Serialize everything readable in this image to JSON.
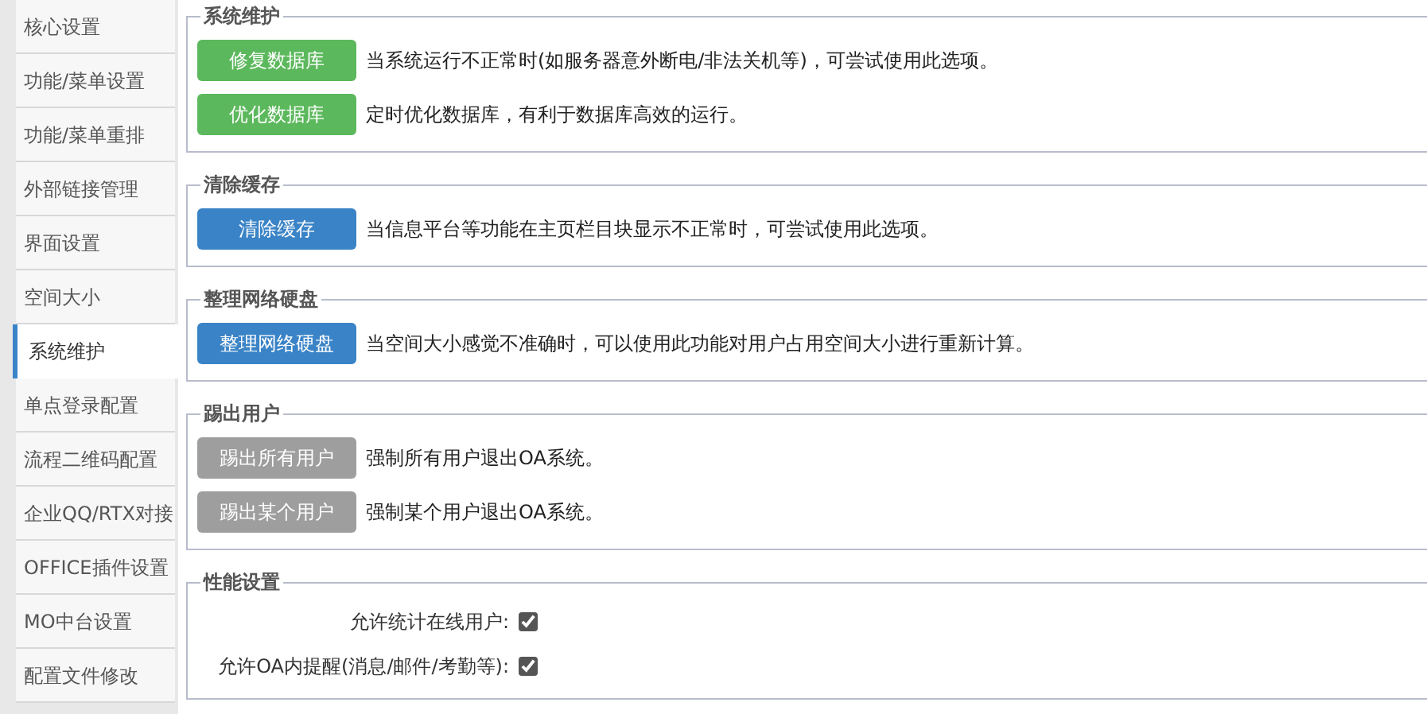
{
  "sidebar": {
    "items": [
      {
        "label": "核心设置",
        "selected": false
      },
      {
        "label": "功能/菜单设置",
        "selected": false
      },
      {
        "label": "功能/菜单重排",
        "selected": false
      },
      {
        "label": "外部链接管理",
        "selected": false
      },
      {
        "label": "界面设置",
        "selected": false
      },
      {
        "label": "空间大小",
        "selected": false
      },
      {
        "label": "系统维护",
        "selected": true
      },
      {
        "label": "单点登录配置",
        "selected": false
      },
      {
        "label": "流程二维码配置",
        "selected": false
      },
      {
        "label": "企业QQ/RTX对接",
        "selected": false
      },
      {
        "label": "OFFICE插件设置",
        "selected": false
      },
      {
        "label": "MO中台设置",
        "selected": false
      },
      {
        "label": "配置文件修改",
        "selected": false
      }
    ]
  },
  "sections": [
    {
      "title": "系统维护",
      "rows": [
        {
          "kind": "button",
          "button": "修复数据库",
          "color": "#5cb85c",
          "description": "当系统运行不正常时(如服务器意外断电/非法关机等)，可尝试使用此选项。"
        },
        {
          "kind": "button",
          "button": "优化数据库",
          "color": "#5cb85c",
          "description": "定时优化数据库，有利于数据库高效的运行。"
        }
      ]
    },
    {
      "title": "清除缓存",
      "rows": [
        {
          "kind": "button",
          "button": "清除缓存",
          "color": "#3a83c6",
          "description": "当信息平台等功能在主页栏目块显示不正常时，可尝试使用此选项。"
        }
      ]
    },
    {
      "title": "整理网络硬盘",
      "rows": [
        {
          "kind": "button",
          "button": "整理网络硬盘",
          "color": "#3a83c6",
          "description": "当空间大小感觉不准确时，可以使用此功能对用户占用空间大小进行重新计算。"
        }
      ]
    },
    {
      "title": "踢出用户",
      "rows": [
        {
          "kind": "button",
          "button": "踢出所有用户",
          "color": "#9e9e9e",
          "description": "强制所有用户退出OA系统。"
        },
        {
          "kind": "button",
          "button": "踢出某个用户",
          "color": "#9e9e9e",
          "description": "强制某个用户退出OA系统。"
        }
      ]
    },
    {
      "title": "性能设置",
      "rows": [
        {
          "kind": "checkbox",
          "label": "允许统计在线用户:",
          "checked": true
        },
        {
          "kind": "checkbox",
          "label": "允许OA内提醒(消息/邮件/考勤等):",
          "checked": true
        }
      ]
    }
  ]
}
